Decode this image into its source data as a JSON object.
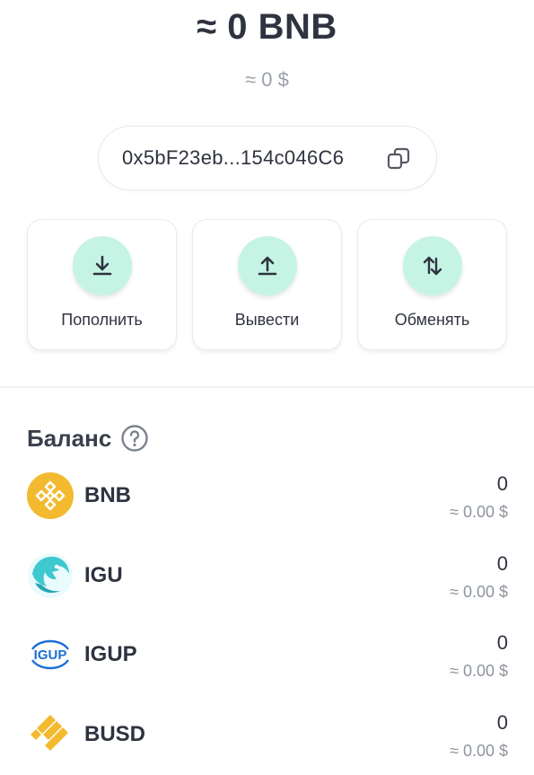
{
  "balance": {
    "main": "≈ 0 BNB",
    "usd": "≈ 0 $"
  },
  "address": {
    "short": "0x5bF23eb...154c046C6",
    "copy_icon": "copy-icon"
  },
  "actions": [
    {
      "label": "Пополнить",
      "icon": "download-icon"
    },
    {
      "label": "Вывести",
      "icon": "upload-icon"
    },
    {
      "label": "Обменять",
      "icon": "swap-icon"
    }
  ],
  "section": {
    "title": "Баланс",
    "help_icon": "question-circle-icon"
  },
  "tokens": [
    {
      "symbol": "BNB",
      "amount": "0",
      "usd": "≈ 0.00 $",
      "logo": "bnb-logo",
      "color": "#f3ba2f"
    },
    {
      "symbol": "IGU",
      "amount": "0",
      "usd": "≈ 0.00 $",
      "logo": "igu-logo",
      "color": "#3ec8d0"
    },
    {
      "symbol": "IGUP",
      "amount": "0",
      "usd": "≈ 0.00 $",
      "logo": "igup-logo",
      "color": "#1b6fd6"
    },
    {
      "symbol": "BUSD",
      "amount": "0",
      "usd": "≈ 0.00 $",
      "logo": "busd-logo",
      "color": "#f3ba2f"
    }
  ],
  "colors": {
    "accent_circle": "#c6f4e4",
    "text_primary": "#2f3340",
    "text_muted": "#9aa0a8"
  }
}
